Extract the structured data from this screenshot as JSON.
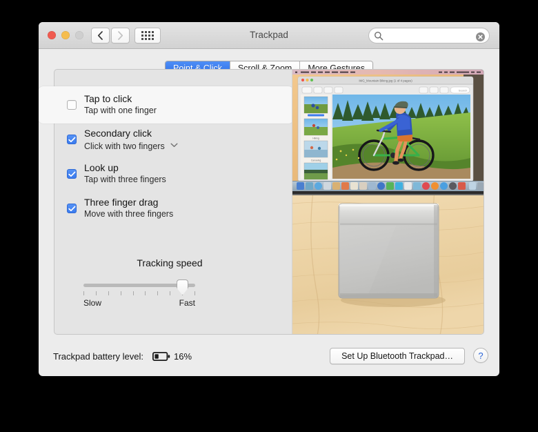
{
  "window": {
    "title": "Trackpad",
    "traffic_lights": [
      {
        "name": "close",
        "color": "#f05b50"
      },
      {
        "name": "minimize",
        "color": "#f5bd4f"
      },
      {
        "name": "zoom",
        "color": "#cfcfcf"
      }
    ],
    "nav": {
      "back_icon": "chevron-left-icon",
      "forward_icon": "chevron-right-icon",
      "show_all_icon": "grid-dots-icon"
    },
    "search": {
      "value": "",
      "placeholder": "",
      "icon": "search-icon",
      "clear_icon": "clear-circle-icon"
    }
  },
  "tabs": [
    {
      "label": "Point & Click",
      "active": true
    },
    {
      "label": "Scroll & Zoom",
      "active": false
    },
    {
      "label": "More Gestures",
      "active": false
    }
  ],
  "options": [
    {
      "title": "Tap to click",
      "subtitle": "Tap with one finger",
      "checked": false,
      "highlighted": true,
      "has_dropdown": false
    },
    {
      "title": "Secondary click",
      "subtitle": "Click with two fingers",
      "checked": true,
      "highlighted": false,
      "has_dropdown": true
    },
    {
      "title": "Look up",
      "subtitle": "Tap with three fingers",
      "checked": true,
      "highlighted": false,
      "has_dropdown": false
    },
    {
      "title": "Three finger drag",
      "subtitle": "Move with three fingers",
      "checked": true,
      "highlighted": false,
      "has_dropdown": false
    }
  ],
  "tracking_speed": {
    "label": "Tracking speed",
    "min_label": "Slow",
    "max_label": "Fast",
    "ticks": 10,
    "value": 9,
    "max": 10
  },
  "battery": {
    "label": "Trackpad battery level:",
    "percent": "16%",
    "fill_ratio": 0.3,
    "icon": "battery-low-icon"
  },
  "footer": {
    "setup_button": "Set Up Bluetooth Trackpad…",
    "help_button": "?",
    "help_icon": "question-mark-icon"
  },
  "preview": {
    "top_caption": "Preview app window with mountain biker photo and Dock",
    "bottom_caption": "Magic Trackpad on wooden desk",
    "accent": "#3b7bee"
  }
}
